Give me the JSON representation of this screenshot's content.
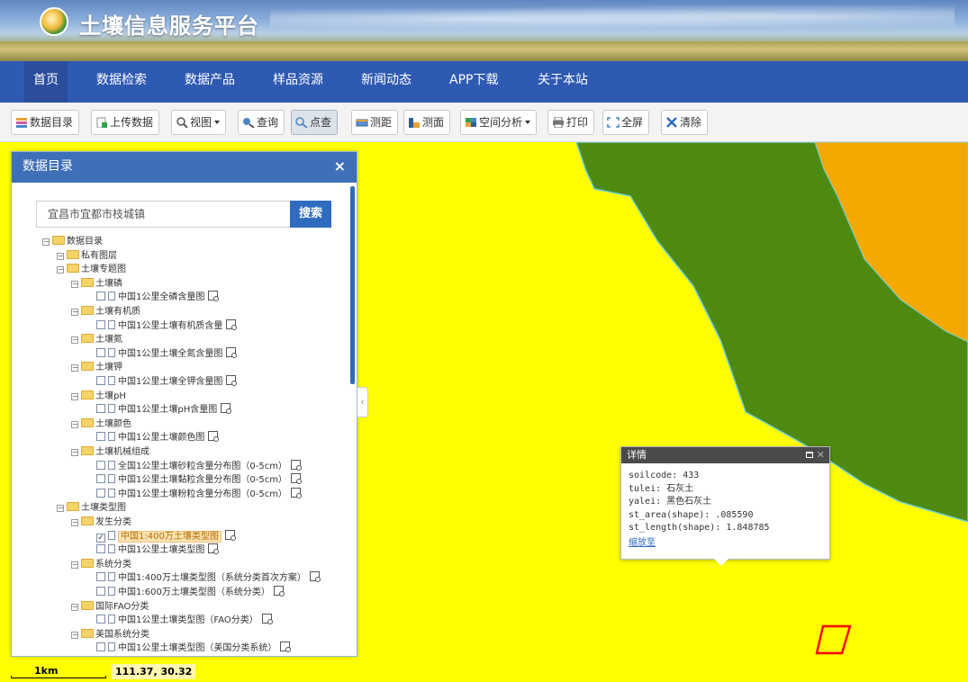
{
  "app": {
    "title": "土壤信息服务平台"
  },
  "nav": {
    "items": [
      "首页",
      "数据检索",
      "数据产品",
      "样品资源",
      "新闻动态",
      "APP下载",
      "关于本站"
    ],
    "active_index": 0
  },
  "toolbar": {
    "buttons": [
      {
        "label": "数据目录",
        "icon": "layers-icon"
      },
      {
        "label": "上传数据",
        "icon": "upload-icon"
      },
      {
        "label": "视图",
        "icon": "magnifier-icon",
        "dropdown": true
      },
      {
        "label": "查询",
        "icon": "query-icon"
      },
      {
        "label": "点查",
        "icon": "point-query-icon",
        "active": true
      },
      {
        "label": "测距",
        "icon": "ruler-icon"
      },
      {
        "label": "测面",
        "icon": "area-icon"
      },
      {
        "label": "空间分析",
        "icon": "analysis-icon",
        "dropdown": true
      },
      {
        "label": "打印",
        "icon": "printer-icon"
      },
      {
        "label": "全屏",
        "icon": "fullscreen-icon"
      },
      {
        "label": "清除",
        "icon": "clear-icon"
      }
    ]
  },
  "catalog": {
    "title": "数据目录",
    "close": "×",
    "search_value": "宜昌市宜都市枝城镇",
    "search_button": "搜索",
    "collapse_glyph": "‹",
    "tree": [
      {
        "label": "数据目录",
        "type": "folder",
        "level": 0
      },
      {
        "label": "私有图层",
        "type": "folder",
        "level": 1
      },
      {
        "label": "土壤专题图",
        "type": "folder",
        "level": 1
      },
      {
        "label": "土壤磷",
        "type": "folder",
        "level": 2
      },
      {
        "label": "中国1公里全磷含量图",
        "type": "layer",
        "level": 3
      },
      {
        "label": "土壤有机质",
        "type": "folder",
        "level": 2
      },
      {
        "label": "中国1公里土壤有机质含量",
        "type": "layer",
        "level": 3
      },
      {
        "label": "土壤氮",
        "type": "folder",
        "level": 2
      },
      {
        "label": "中国1公里土壤全氮含量图",
        "type": "layer",
        "level": 3
      },
      {
        "label": "土壤钾",
        "type": "folder",
        "level": 2
      },
      {
        "label": "中国1公里土壤全钾含量图",
        "type": "layer",
        "level": 3
      },
      {
        "label": "土壤pH",
        "type": "folder",
        "level": 2
      },
      {
        "label": "中国1公里土壤pH含量图",
        "type": "layer",
        "level": 3
      },
      {
        "label": "土壤颜色",
        "type": "folder",
        "level": 2
      },
      {
        "label": "中国1公里土壤颜色图",
        "type": "layer",
        "level": 3
      },
      {
        "label": "土壤机械组成",
        "type": "folder",
        "level": 2
      },
      {
        "label": "全国1公里土壤砂粒含量分布图（0-5cm）",
        "type": "layer",
        "level": 3
      },
      {
        "label": "中国1公里土壤黏粒含量分布图（0-5cm）",
        "type": "layer",
        "level": 3
      },
      {
        "label": "中国1公里土壤粉粒含量分布图（0-5cm）",
        "type": "layer",
        "level": 3
      },
      {
        "label": "土壤类型图",
        "type": "folder",
        "level": 1
      },
      {
        "label": "发生分类",
        "type": "folder",
        "level": 2
      },
      {
        "label": "中国1:400万土壤类型图",
        "type": "layer",
        "level": 3,
        "checked": true,
        "selected": true
      },
      {
        "label": "中国1公里土壤类型图",
        "type": "layer",
        "level": 3
      },
      {
        "label": "系统分类",
        "type": "folder",
        "level": 2
      },
      {
        "label": "中国1:400万土壤类型图（系统分类首次方案）",
        "type": "layer",
        "level": 3
      },
      {
        "label": "中国1:600万土壤类型图（系统分类）",
        "type": "layer",
        "level": 3
      },
      {
        "label": "国际FAO分类",
        "type": "folder",
        "level": 2
      },
      {
        "label": "中国1公里土壤类型图（FAO分类）",
        "type": "layer",
        "level": 3
      },
      {
        "label": "美国系统分类",
        "type": "folder",
        "level": 2
      },
      {
        "label": "中国1公里土壤类型图（美国分类系统）",
        "type": "layer",
        "level": 3
      }
    ]
  },
  "popup": {
    "title": "详情",
    "lines": [
      "soilcode: 433",
      "tulei: 石灰土",
      "yalei: 黑色石灰土",
      "st_area(shape): .085590",
      "st_length(shape): 1.848785"
    ],
    "zoom_link": "缩放至"
  },
  "map": {
    "colors": {
      "background": "#ffff00",
      "green": "#4f8a10",
      "orange": "#f5a800",
      "boundary": "#6fd6e0",
      "selection": "#ff0000"
    }
  },
  "scale": {
    "label": "1km"
  },
  "coords": {
    "text": "111.37, 30.32"
  }
}
